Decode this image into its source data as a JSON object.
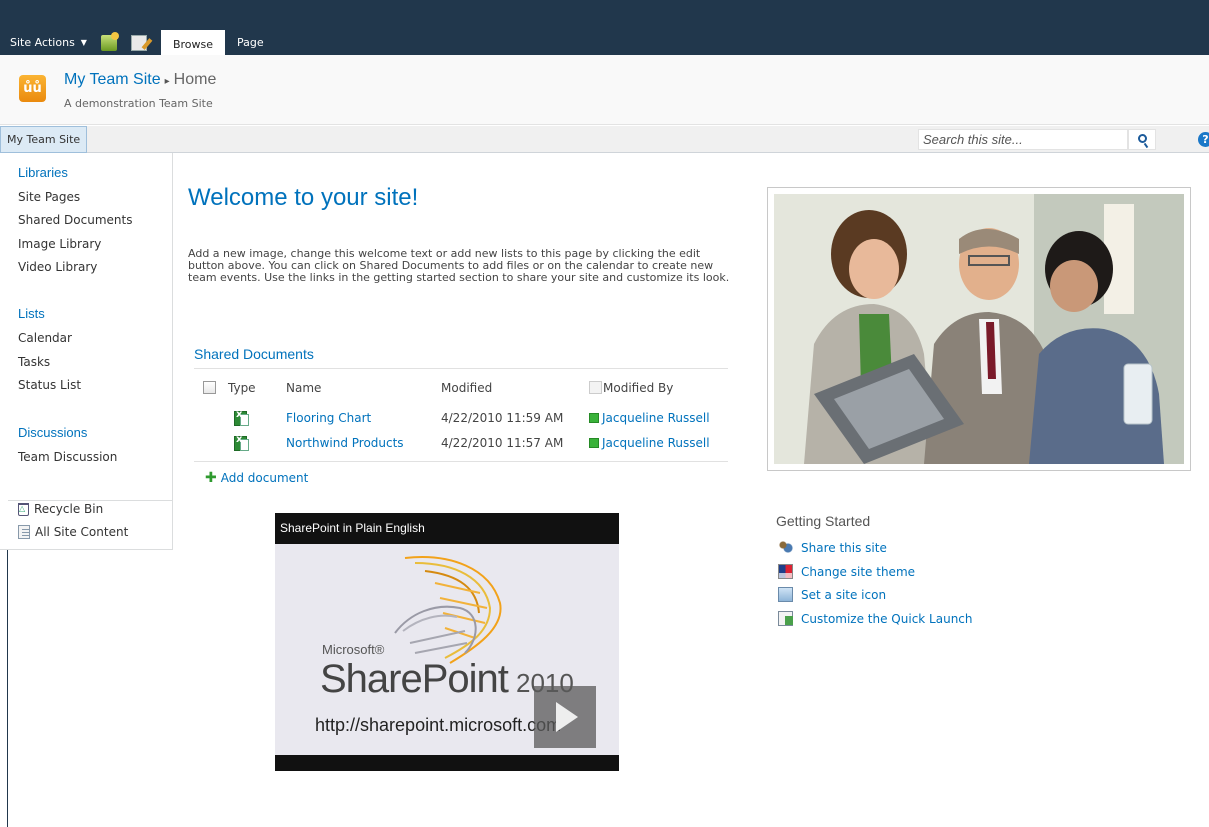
{
  "ribbon": {
    "site_actions": "Site Actions",
    "tabs": [
      "Browse",
      "Page"
    ],
    "active_tab": "Browse"
  },
  "header": {
    "site_title": "My Team Site",
    "breadcrumb_separator": "▸",
    "page_name": "Home",
    "description": "A demonstration Team Site"
  },
  "topnav": {
    "items": [
      "My Team Site"
    ],
    "search_placeholder": "Search this site...",
    "help_glyph": "?"
  },
  "quick_launch": {
    "libraries_heading": "Libraries",
    "libraries": [
      "Site Pages",
      "Shared Documents",
      "Image Library",
      "Video Library"
    ],
    "lists_heading": "Lists",
    "lists": [
      "Calendar",
      "Tasks",
      "Status List"
    ],
    "discussions_heading": "Discussions",
    "discussions": [
      "Team Discussion"
    ],
    "recycle_bin": "Recycle Bin",
    "all_site_content": "All Site Content"
  },
  "main": {
    "welcome_title": "Welcome to your site!",
    "intro_text": "Add a new image, change this welcome text or add new lists to this page by clicking the edit button above. You can click on Shared Documents to add files or on the calendar to create new team events. Use the links in the getting started section to share your site and customize its look."
  },
  "shared_documents": {
    "title": "Shared Documents",
    "columns": [
      "Type",
      "Name",
      "Modified",
      "Modified By"
    ],
    "rows": [
      {
        "type_icon": "excel-icon",
        "name": "Flooring Chart",
        "modified": "4/22/2010 11:59 AM",
        "modified_by": "Jacqueline Russell"
      },
      {
        "type_icon": "excel-icon",
        "name": "Northwind Products",
        "modified": "4/22/2010 11:57 AM",
        "modified_by": "Jacqueline Russell"
      }
    ],
    "add_document": "Add document"
  },
  "video": {
    "title": "SharePoint in Plain English",
    "brand_small": "Microsoft®",
    "brand_name": "SharePoint",
    "brand_year": "2010",
    "url": "http://sharepoint.microsoft.com"
  },
  "getting_started": {
    "title": "Getting Started",
    "items": [
      {
        "label": "Share this site",
        "icon": "share-icon"
      },
      {
        "label": "Change site theme",
        "icon": "theme-icon"
      },
      {
        "label": "Set a site icon",
        "icon": "image-icon"
      },
      {
        "label": "Customize the Quick Launch",
        "icon": "quick-launch-icon"
      }
    ]
  },
  "colors": {
    "ribbon": "#21374c",
    "link": "#0072bc",
    "logo_orange": "#f7a22a"
  }
}
